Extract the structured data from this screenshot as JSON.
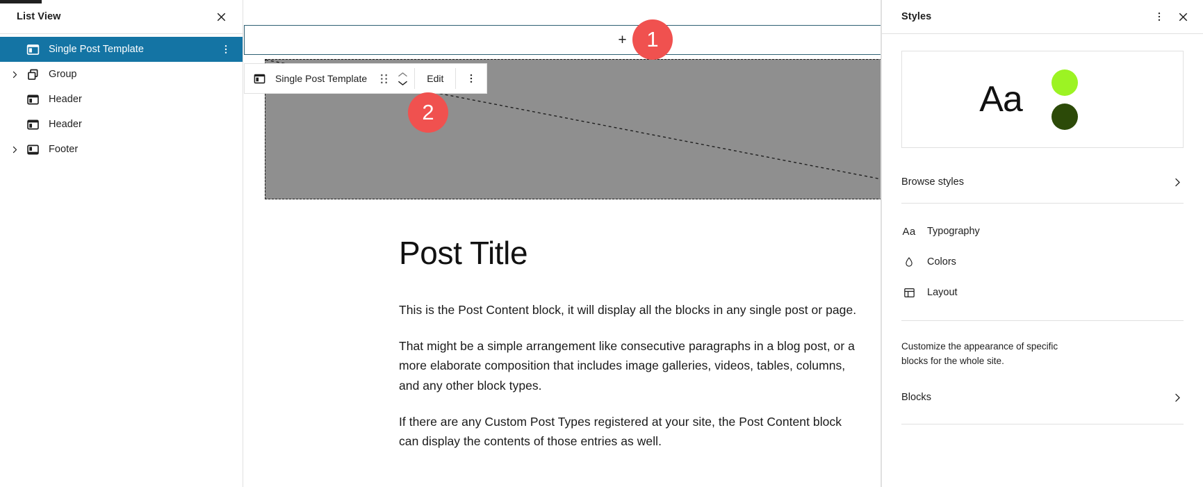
{
  "list_view": {
    "title": "List View",
    "close_label": "×",
    "items": [
      {
        "label": "Single Post Template",
        "icon": "template-icon",
        "expandable": false,
        "selected": true
      },
      {
        "label": "Group",
        "icon": "group-icon",
        "expandable": true,
        "selected": false
      },
      {
        "label": "Header",
        "icon": "header-icon",
        "expandable": false,
        "selected": false
      },
      {
        "label": "Header",
        "icon": "header-icon",
        "expandable": false,
        "selected": false
      },
      {
        "label": "Footer",
        "icon": "footer-icon",
        "expandable": true,
        "selected": false
      }
    ]
  },
  "canvas": {
    "appender": {
      "icon": "plus-icon",
      "label": "+"
    },
    "block_toolbar": {
      "block_icon": "template-icon",
      "block_name": "Single Post Template",
      "drag_handle_icon": "drag-handle-icon",
      "move_up_icon": "chevron-up-icon",
      "move_down_icon": "chevron-down-icon",
      "edit_label": "Edit",
      "options_icon": "more-vertical-icon"
    },
    "placeholder": {
      "fill_color": "#8f8f8f",
      "border_style": "dashed"
    },
    "post": {
      "title": "Post Title",
      "paragraphs": [
        "This is the Post Content block, it will display all the blocks in any single post or page.",
        "That might be a simple arrangement like consecutive paragraphs in a blog post, or a more elaborate composition that includes image galleries, videos, tables, columns, and any other block types.",
        "If there are any Custom Post Types registered at your site, the Post Content block can display the contents of those entries as well."
      ]
    }
  },
  "annotations": [
    {
      "number": "1",
      "color": "#f0514f"
    },
    {
      "number": "2",
      "color": "#f0514f"
    }
  ],
  "styles_panel": {
    "title": "Styles",
    "more_icon": "more-vertical-icon",
    "close_icon": "close-icon",
    "preview": {
      "sample_text": "Aa",
      "swatches": [
        "#9cf323",
        "#2c4a08"
      ]
    },
    "browse_styles": {
      "label": "Browse styles",
      "chevron": "chevron-right-icon"
    },
    "menu": [
      {
        "label": "Typography",
        "icon": "typography-icon"
      },
      {
        "label": "Colors",
        "icon": "droplet-icon"
      },
      {
        "label": "Layout",
        "icon": "layout-icon"
      }
    ],
    "description": "Customize the appearance of specific blocks for the whole site.",
    "blocks_link": {
      "label": "Blocks",
      "chevron": "chevron-right-icon"
    }
  },
  "theme": {
    "selected_row_bg": "#1474a4",
    "accent_border": "#2d5f72",
    "badge_red": "#f0514f"
  }
}
